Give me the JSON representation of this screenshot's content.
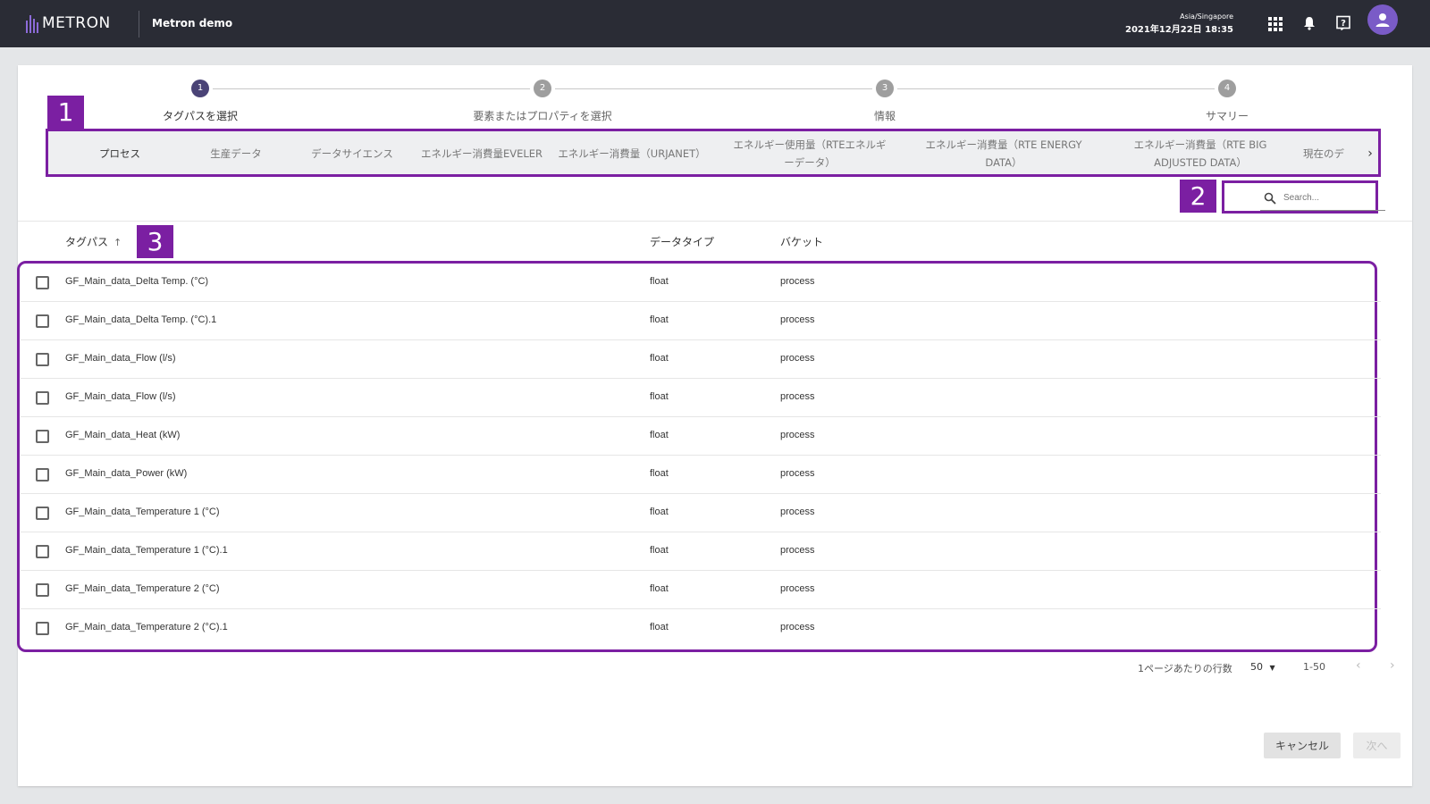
{
  "header": {
    "logo_text": "METRON",
    "app_name": "Metron demo",
    "timezone": "Asia/Singapore",
    "datetime": "2021年12月22日 18:35",
    "icons": [
      "apps-grid-icon",
      "bell-icon",
      "help-icon",
      "user-avatar-icon"
    ]
  },
  "stepper": {
    "steps": [
      {
        "number": "1",
        "label": "タグパスを選択",
        "active": true
      },
      {
        "number": "2",
        "label": "要素またはプロパティを選択",
        "active": false
      },
      {
        "number": "3",
        "label": "情報",
        "active": false
      },
      {
        "number": "4",
        "label": "サマリー",
        "active": false
      }
    ]
  },
  "tabs": {
    "items": [
      {
        "label": "プロセス",
        "active": true
      },
      {
        "label": "生産データ"
      },
      {
        "label": "データサイエンス"
      },
      {
        "label": "エネルギー消費量EVELER"
      },
      {
        "label": "エネルギー消費量（URJANET）"
      },
      {
        "label": "エネルギー使用量（RTEエネルギーデータ）"
      },
      {
        "label": "エネルギー消費量（RTE ENERGY DATA）"
      },
      {
        "label": "エネルギー消費量（RTE BIG ADJUSTED DATA）"
      },
      {
        "label": "現在のデ"
      }
    ],
    "next_icon": "chevron-right-icon"
  },
  "search": {
    "placeholder": "Search..."
  },
  "annotations": [
    "1",
    "2",
    "3"
  ],
  "table": {
    "columns": {
      "tagpath": "タグパス",
      "sort_indicator": "↑",
      "datatype": "データタイプ",
      "bucket": "バケット"
    },
    "rows": [
      {
        "tagpath": "GF_Main_data_Delta Temp. (°C)",
        "datatype": "float",
        "bucket": "process"
      },
      {
        "tagpath": "GF_Main_data_Delta Temp. (°C).1",
        "datatype": "float",
        "bucket": "process"
      },
      {
        "tagpath": "GF_Main_data_Flow (l/s)",
        "datatype": "float",
        "bucket": "process"
      },
      {
        "tagpath": "GF_Main_data_Flow (l/s)",
        "datatype": "float",
        "bucket": "process"
      },
      {
        "tagpath": "GF_Main_data_Heat (kW)",
        "datatype": "float",
        "bucket": "process"
      },
      {
        "tagpath": "GF_Main_data_Power (kW)",
        "datatype": "float",
        "bucket": "process"
      },
      {
        "tagpath": "GF_Main_data_Temperature 1 (°C)",
        "datatype": "float",
        "bucket": "process"
      },
      {
        "tagpath": "GF_Main_data_Temperature 1 (°C).1",
        "datatype": "float",
        "bucket": "process"
      },
      {
        "tagpath": "GF_Main_data_Temperature 2 (°C)",
        "datatype": "float",
        "bucket": "process"
      },
      {
        "tagpath": "GF_Main_data_Temperature 2 (°C).1",
        "datatype": "float",
        "bucket": "process"
      }
    ]
  },
  "pagination": {
    "rows_per_page_label": "1ページあたりの行数",
    "rows_per_page_value": "50",
    "range": "1-50",
    "prev_icon": "‹",
    "next_icon": "›"
  },
  "actions": {
    "cancel": "キャンセル",
    "next": "次へ"
  },
  "colors": {
    "accent": "#4a4376",
    "annotation": "#7b1fa2",
    "topbar": "#2a2c35"
  }
}
